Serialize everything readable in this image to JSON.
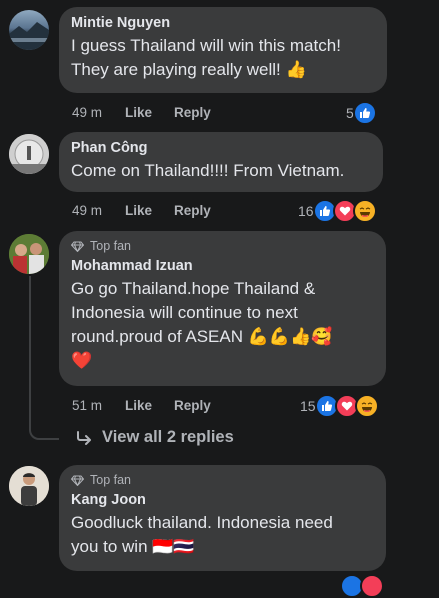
{
  "comments": [
    {
      "author": "Mintie Nguyen",
      "text_lines": [
        "I guess Thailand will win this match!",
        "They are playing really well! 👍"
      ],
      "time": "49 m",
      "like": "Like",
      "reply": "Reply",
      "reaction_count": "5",
      "reactions": [
        "like-icon"
      ]
    },
    {
      "author": "Phan Công",
      "text_lines": [
        "Come on Thailand!!!! From Vietnam."
      ],
      "time": "49 m",
      "like": "Like",
      "reply": "Reply",
      "reaction_count": "16",
      "reactions": [
        "like-icon",
        "love-icon",
        "haha-icon"
      ]
    },
    {
      "badge": "Top fan",
      "author": "Mohammad Izuan",
      "text_lines": [
        "Go go Thailand.hope Thailand &",
        "Indonesia will continue to next",
        "round.proud of ASEAN 💪💪👍🥰",
        "❤️"
      ],
      "time": "51 m",
      "like": "Like",
      "reply": "Reply",
      "reaction_count": "15",
      "reactions": [
        "like-icon",
        "love-icon",
        "haha-icon"
      ]
    },
    {
      "badge": "Top fan",
      "author": "Kang Joon",
      "text_lines": [
        "Goodluck thailand. Indonesia need",
        "you to win 🇮🇩🇹🇭"
      ]
    }
  ],
  "view_replies": "View all 2 replies"
}
